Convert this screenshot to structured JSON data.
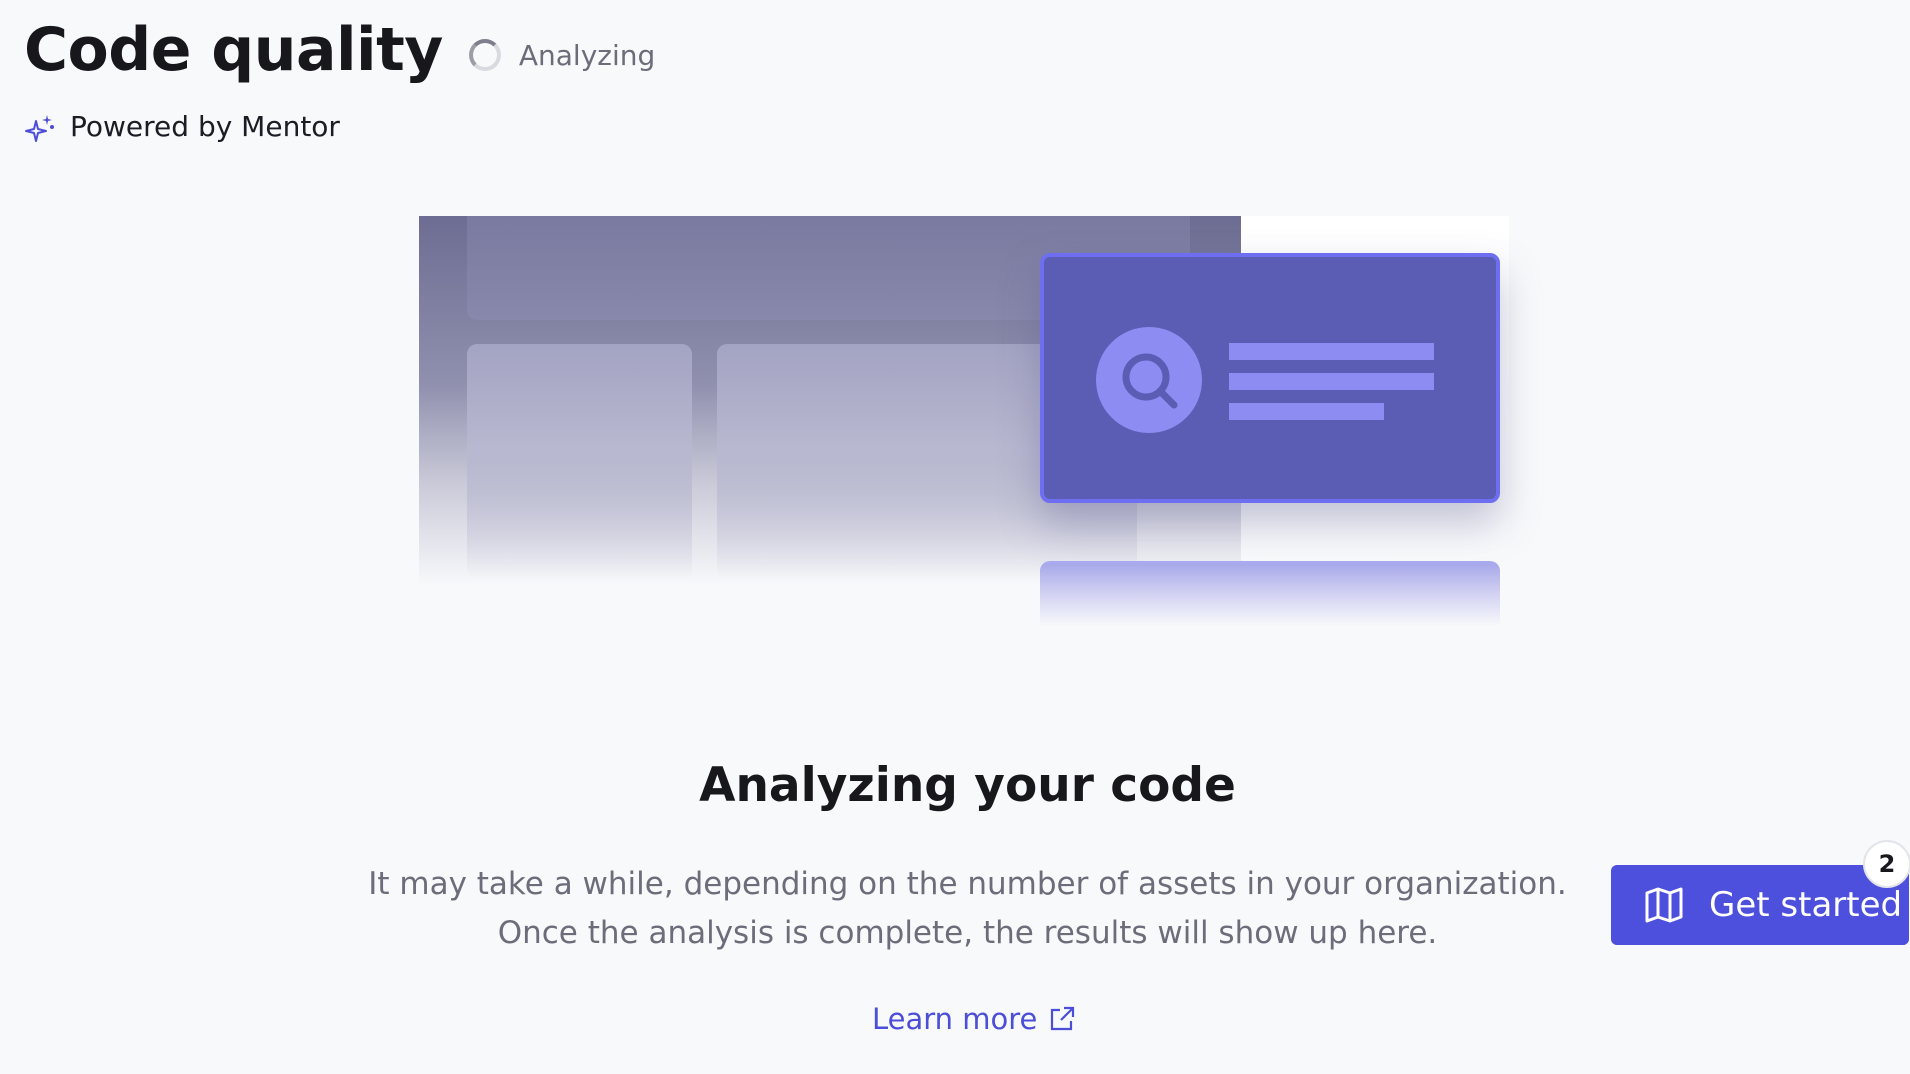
{
  "header": {
    "title": "Code quality",
    "status_text": "Analyzing",
    "powered_by": "Powered by Mentor"
  },
  "main": {
    "heading": "Analyzing your code",
    "description": "It may take a while, depending on the number of assets in your organization. Once the analysis is complete, the results will show up here.",
    "learn_more": "Learn more"
  },
  "get_started": {
    "label": "Get started",
    "badge_count": "2"
  },
  "colors": {
    "accent": "#4d4fdd",
    "link": "#4c4ed8",
    "card": "#5b5cb4"
  }
}
